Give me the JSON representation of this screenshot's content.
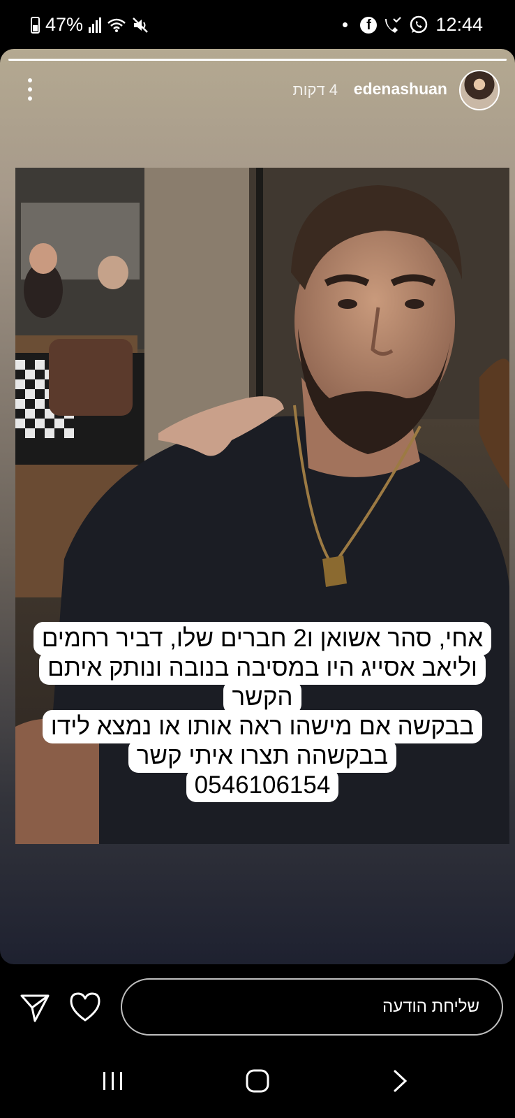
{
  "status_bar": {
    "battery": "47%",
    "time": "12:44"
  },
  "story": {
    "username": "edenashuan",
    "timestamp": "4 דקות",
    "progress": 1.0,
    "overlay_lines": [
      "אחי, סהר אשואן ו2 חברים שלו, דביר רחמים",
      "וליאב אסייג היו במסיבה בנובה ונותק איתם",
      "הקשר",
      "בבקשה אם מישהו ראה אותו או נמצא לידו",
      "בבקשהה תצרו איתי קשר",
      "0546106154"
    ]
  },
  "bottom_bar": {
    "message_placeholder": "שליחת הודעה"
  },
  "icons": {
    "battery": "battery-icon",
    "signal": "signal-icon",
    "wifi": "wifi-icon",
    "mute": "mute-icon",
    "facebook": "facebook-icon",
    "missed_call": "missed-call-icon",
    "whatsapp": "whatsapp-icon",
    "more": "more-vertical-icon",
    "send": "send-icon",
    "like": "heart-icon"
  }
}
